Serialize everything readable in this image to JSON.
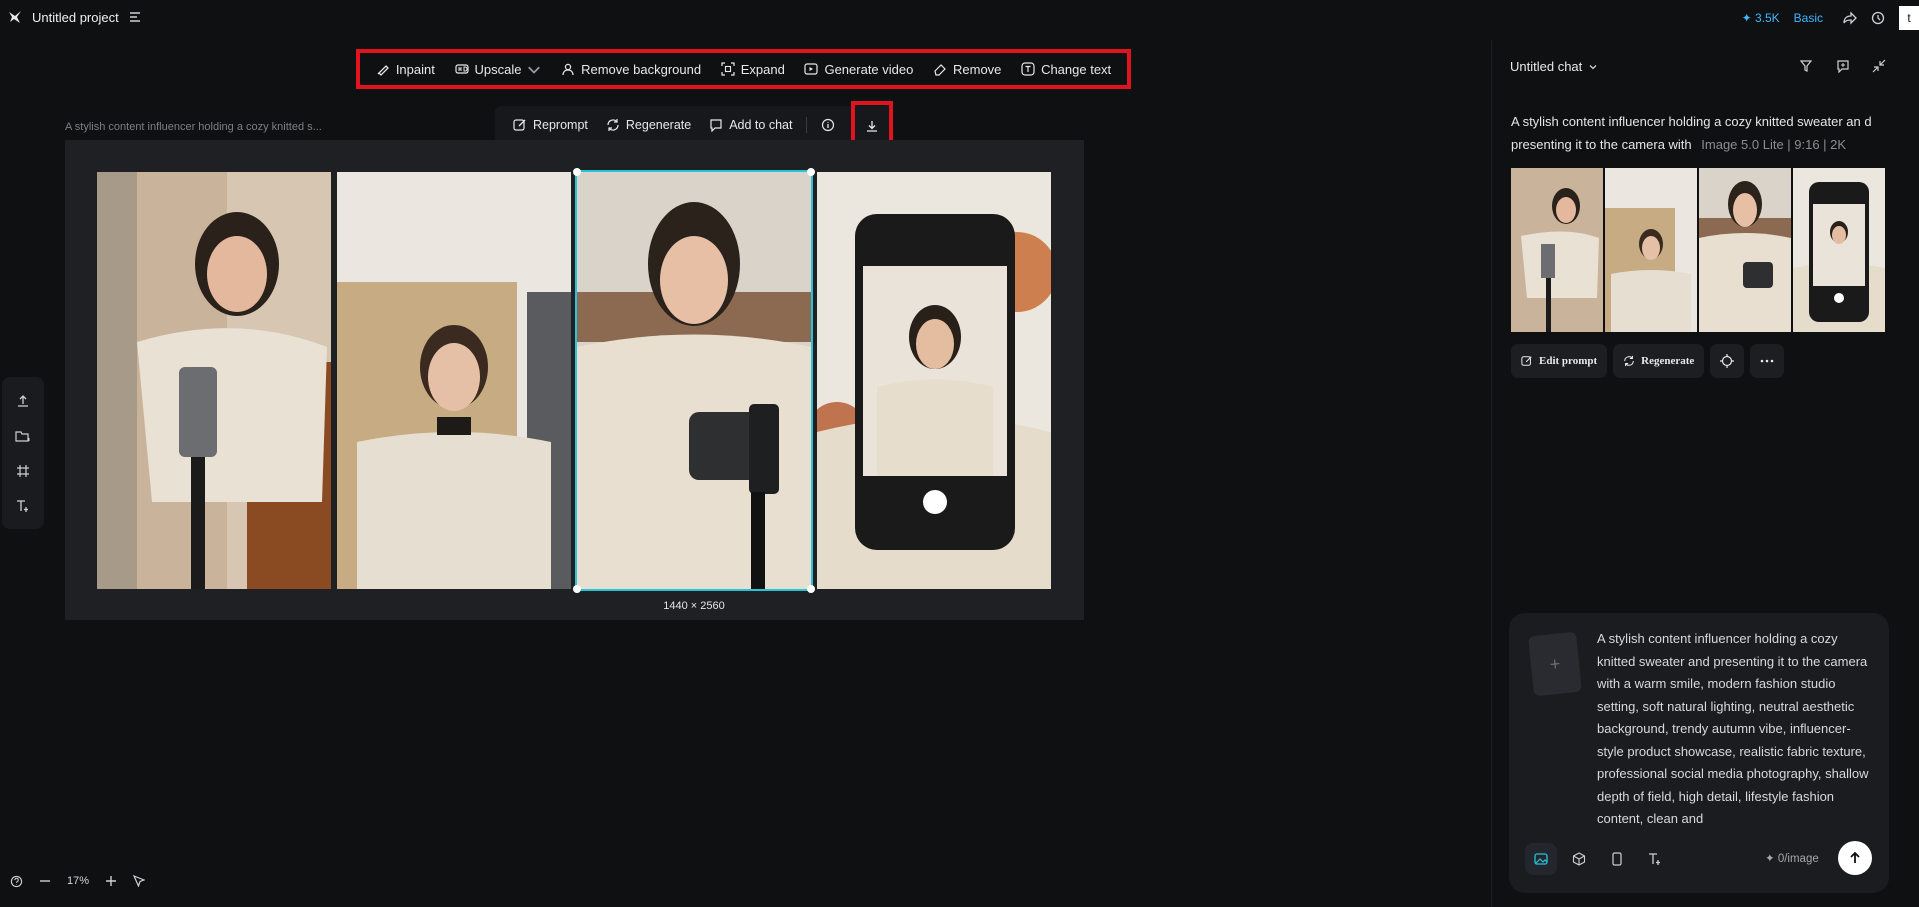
{
  "app": {
    "project_title": "Untitled project"
  },
  "topbar": {
    "credits": "✦ 3.5K",
    "plan": "Basic",
    "account_initial": "t"
  },
  "edit_toolbar": {
    "inpaint": "Inpaint",
    "upscale": "Upscale",
    "remove_background": "Remove background",
    "expand": "Expand",
    "generate_video": "Generate video",
    "remove": "Remove",
    "change_text": "Change text"
  },
  "image_actions": {
    "reprompt": "Reprompt",
    "regenerate": "Regenerate",
    "add_to_chat": "Add to chat"
  },
  "canvas": {
    "caption": "A stylish content influencer holding a cozy knitted s...",
    "dimensions": "1440 × 2560"
  },
  "zoom": {
    "level": "17%"
  },
  "chat": {
    "title": "Untitled chat",
    "generation_prompt": "A stylish content influencer holding a cozy knitted sweater an d presenting it to the camera with",
    "generation_meta": "Image 5.0 Lite | 9:16 | 2K",
    "buttons": {
      "edit_prompt": "Edit prompt",
      "regenerate": "Regenerate"
    }
  },
  "prompt_box": {
    "text": "A stylish content influencer holding a cozy knitted sweater and presenting it to the camera with a warm smile, modern fashion studio setting, soft natural lighting, neutral aesthetic background, trendy autumn vibe, influencer-style product showcase, realistic fabric texture, professional social media photography, shallow depth of field, high detail, lifestyle fashion content, clean and",
    "cost": "✦ 0/image"
  },
  "colors": {
    "accent": "#27c3d6",
    "highlight": "#e0141e",
    "brand_link": "#3fb6ff",
    "background": "#0f1012"
  }
}
